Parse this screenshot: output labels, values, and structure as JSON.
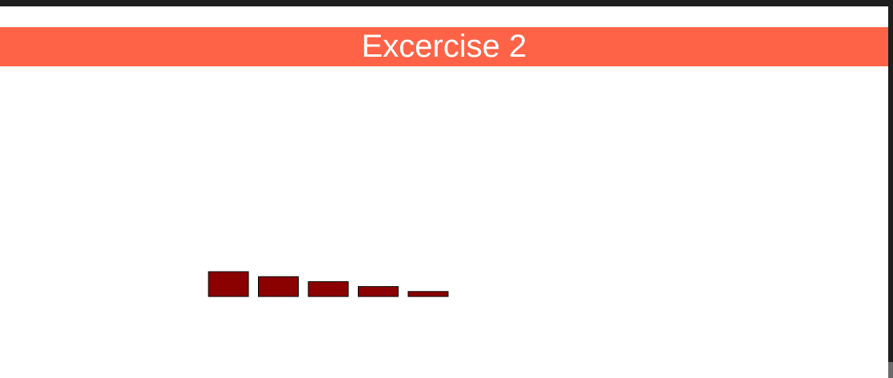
{
  "header": {
    "title": "Excercise 2"
  },
  "colors": {
    "banner": "#ff6347",
    "bar_fill": "#8b0000",
    "bar_stroke": "#000000",
    "title_text": "#ffffff"
  },
  "chart_data": {
    "type": "bar",
    "categories": [
      "",
      "",
      "",
      "",
      ""
    ],
    "values": [
      5,
      4,
      3,
      2,
      1
    ],
    "title": "",
    "xlabel": "",
    "ylabel": "",
    "ylim": [
      0,
      5
    ],
    "grid": false,
    "legend": "none"
  }
}
